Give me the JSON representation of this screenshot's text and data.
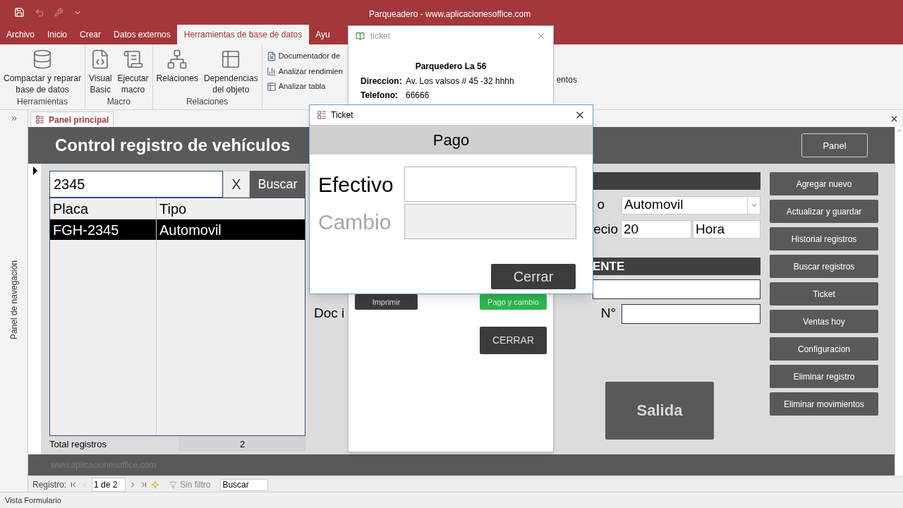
{
  "window": {
    "title": "Parqueadero - www.aplicacionesoffice.com"
  },
  "ribbon": {
    "tabs": [
      {
        "label": "Archivo",
        "selected": false
      },
      {
        "label": "Inicio",
        "selected": false
      },
      {
        "label": "Crear",
        "selected": false
      },
      {
        "label": "Datos externos",
        "selected": false
      },
      {
        "label": "Herramientas de base de datos",
        "selected": true
      },
      {
        "label": "Ayu",
        "selected": false
      }
    ],
    "groups": [
      {
        "label": "Herramientas",
        "buttons": [
          {
            "label": "Compactar y reparar\nbase de datos"
          }
        ]
      },
      {
        "label": "Macro",
        "buttons": [
          {
            "label": "Visual\nBasic"
          },
          {
            "label": "Ejecutar\nmacro"
          }
        ]
      },
      {
        "label": "Relaciones",
        "buttons": [
          {
            "label": "Relaciones"
          },
          {
            "label": "Dependencias\ndel objeto"
          }
        ]
      }
    ],
    "small_buttons": [
      {
        "label": "Documentador de"
      },
      {
        "label": "Analizar rendimien"
      },
      {
        "label": "Analizar tabla"
      }
    ],
    "cut_label": "entos"
  },
  "nav_pane": {
    "label": "Panel de navegación"
  },
  "document_tab": {
    "label": "Panel principal"
  },
  "form": {
    "title": "Control registro de vehículos",
    "panel_button": "Panel",
    "search": {
      "value": "2345",
      "clear": "X",
      "button": "Buscar"
    },
    "list": {
      "columns": [
        "Placa",
        "Tipo"
      ],
      "rows": [
        {
          "cells": [
            "FGH-2345",
            "Automovil"
          ],
          "selected": true
        }
      ]
    },
    "total": {
      "label": "Total registros",
      "value": "2"
    },
    "fields": {
      "type_label": "o",
      "type_value": "Automovil",
      "price_label": "ecio",
      "price_value": "20",
      "unit_value": "Hora",
      "section_label": "ENTE",
      "doc_label": "Doc i",
      "number_label": "N°"
    },
    "exit_button": "Salida",
    "actions": [
      "Agregar nuevo",
      "Actualizar y guardar",
      "Historial registros",
      "Buscar registros",
      "Ticket",
      "Ventas hoy",
      "Configuracion",
      "Eliminar registro",
      "Eliminar movimientos"
    ],
    "footer": "www.aplicacionesoffice.com"
  },
  "record_nav": {
    "label": "Registro:",
    "position": "1 de 2",
    "filter": "Sin filtro",
    "search_placeholder": "Buscar"
  },
  "status_bar": "Vista Formulario",
  "ticket_window": {
    "title": "ticket",
    "business": "Parquedero La 56",
    "lines": [
      {
        "label": "Direccion:",
        "value": "Av. Los valsos # 45 -32 hhhh"
      },
      {
        "label": "Telefono:",
        "value": "66666"
      }
    ],
    "buttons": [
      {
        "label": "Imprimir",
        "kind": "dark"
      },
      {
        "label": "Pago y cambio",
        "kind": "green"
      }
    ],
    "close_button": "CERRAR"
  },
  "dialog": {
    "title": "Ticket",
    "heading": "Pago",
    "fields": [
      {
        "label": "Efectivo",
        "disabled": false
      },
      {
        "label": "Cambio",
        "disabled": true
      }
    ],
    "button": "Cerrar"
  }
}
